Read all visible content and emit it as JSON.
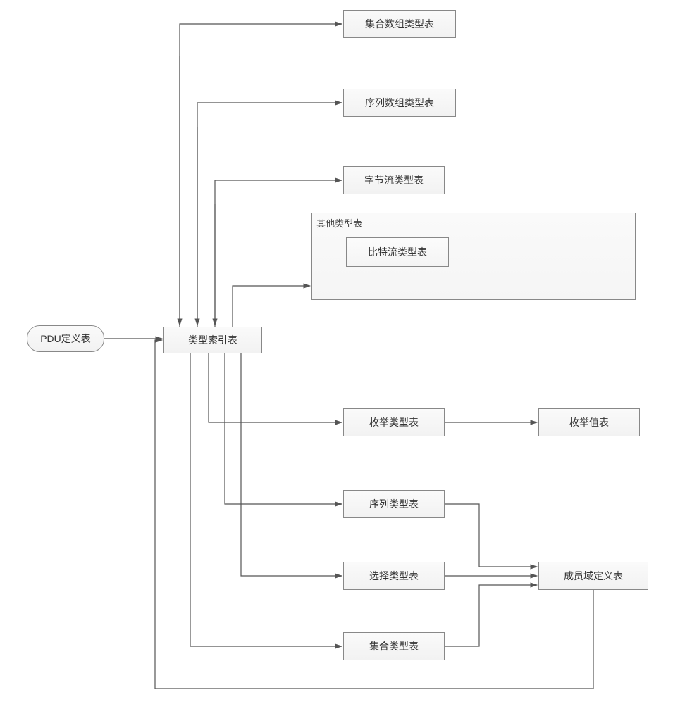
{
  "nodes": {
    "pdu": "PDU定义表",
    "typeIndex": "类型索引表",
    "setArrayType": "集合数组类型表",
    "seqArrayType": "序列数组类型表",
    "byteStreamType": "字节流类型表",
    "otherTypes": "其他类型表",
    "bitStreamType": "比特流类型表",
    "enumType": "枚举类型表",
    "enumValue": "枚举值表",
    "seqType": "序列类型表",
    "choiceType": "选择类型表",
    "memberField": "成员域定义表",
    "setType": "集合类型表"
  },
  "edges": [
    {
      "from": "pdu",
      "to": "typeIndex",
      "dir": "right"
    },
    {
      "from": "typeIndex",
      "to": "setArrayType"
    },
    {
      "from": "typeIndex",
      "to": "seqArrayType"
    },
    {
      "from": "typeIndex",
      "to": "byteStreamType"
    },
    {
      "from": "typeIndex",
      "to": "otherTypes"
    },
    {
      "from": "typeIndex",
      "to": "enumType"
    },
    {
      "from": "typeIndex",
      "to": "seqType"
    },
    {
      "from": "typeIndex",
      "to": "choiceType"
    },
    {
      "from": "typeIndex",
      "to": "setType"
    },
    {
      "from": "enumType",
      "to": "enumValue"
    },
    {
      "from": "choiceType",
      "to": "memberField"
    },
    {
      "from": "seqType",
      "to": "memberField",
      "via": "down"
    },
    {
      "from": "setType",
      "to": "memberField",
      "via": "up"
    },
    {
      "from": "setArrayType",
      "to": "typeIndex",
      "back": true
    },
    {
      "from": "seqArrayType",
      "to": "typeIndex",
      "back": true
    },
    {
      "from": "byteStreamType",
      "to": "typeIndex",
      "back": true
    },
    {
      "from": "memberField",
      "to": "typeIndex",
      "back": true
    }
  ]
}
